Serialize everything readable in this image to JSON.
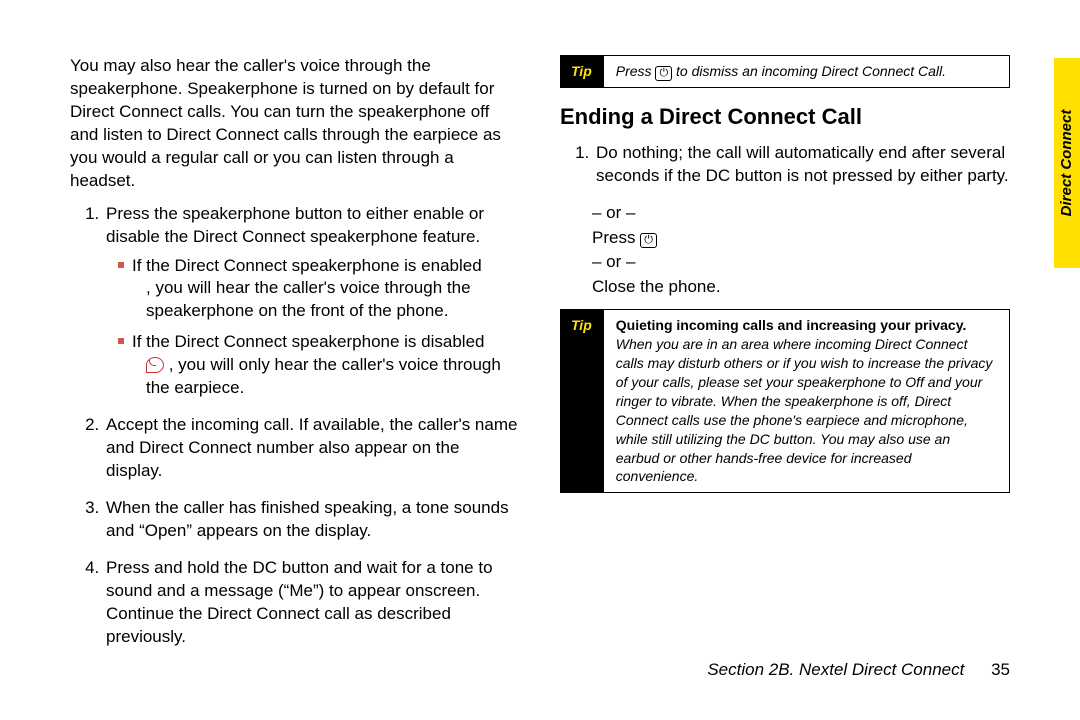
{
  "left": {
    "intro": "You may also hear the caller's voice through the speakerphone. Speakerphone is turned on by default for Direct Connect calls. You can turn the speakerphone off and listen to Direct Connect calls through the earpiece as you would a regular call or you can listen through a headset.",
    "step1": "Press the speakerphone button to either enable or disable the Direct Connect speakerphone feature.",
    "sub1a": "If the Direct Connect speakerphone is enabled",
    "sub1a2": ", you will hear the caller's voice through the speakerphone on the front of the phone.",
    "sub1b": "If the Direct Connect speakerphone is disabled",
    "sub1b2": ", you will only hear the caller's voice through the earpiece.",
    "step2": "Accept the incoming call. If available, the caller's name and Direct Connect number also appear on the display.",
    "step3": "When the caller has finished speaking, a tone sounds and “Open” appears on the display.",
    "step4": "Press and hold the DC button and wait for a tone to sound and a message (“Me”) to appear onscreen. Continue the Direct Connect call as described previously."
  },
  "right": {
    "tip1_label": "Tip",
    "tip1_pre": "Press",
    "tip1_post": "to dismiss an incoming Direct Connect Call.",
    "heading": "Ending a Direct Connect Call",
    "end1": "Do nothing; the call will automatically end after several seconds if the DC button is not pressed by either party.",
    "or": "– or –",
    "press": "Press",
    "close": "Close the phone.",
    "tip2_label": "Tip",
    "tip2_head": "Quieting incoming calls and increasing your privacy.",
    "tip2_body": "When you are in an area where incoming Direct Connect calls may disturb others or if you wish to increase the privacy of your calls, please set your speakerphone to Off and your ringer to vibrate. When the speakerphone is off, Direct Connect calls use the phone's earpiece and microphone, while still utilizing the DC button. You may also use an earbud or other hands-free device for increased convenience."
  },
  "footer": {
    "section": "Section 2B. Nextel Direct Connect",
    "page": "35"
  },
  "tab": "Direct Connect"
}
